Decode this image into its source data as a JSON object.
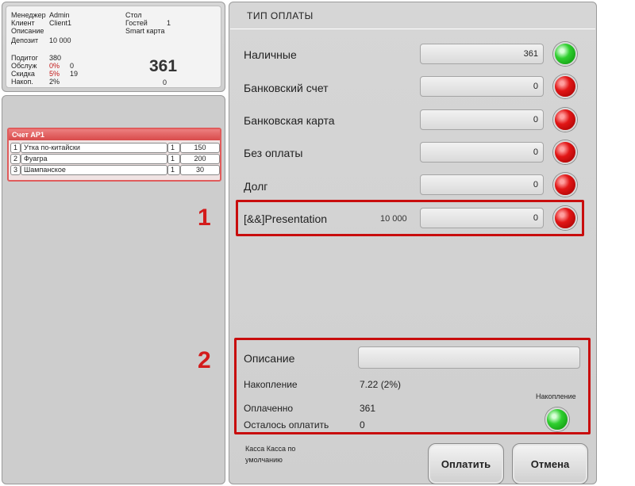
{
  "info": {
    "manager_label": "Менеджер",
    "manager_value": "Admin",
    "client_label": "Клиент",
    "client_value": "Client1",
    "description_label": "Описание",
    "deposit_label": "Депозит",
    "deposit_value": "10 000",
    "table_label": "Стол",
    "guests_label": "Гостей",
    "guests_value": "1",
    "card_label": "Smart карта",
    "subtotal_label": "Подитог",
    "subtotal_value": "380",
    "service_label": "Обслуж",
    "service_pct": "0%",
    "service_value": "0",
    "discount_label": "Скидка",
    "discount_pct": "5%",
    "discount_value": "19",
    "accum_label": "Накоп.",
    "accum_pct": "2%",
    "total": "361",
    "total_sub": "0"
  },
  "bill": {
    "title": "Счет AP1",
    "items": [
      {
        "num": "1",
        "name": "Утка по-китайски",
        "qty": "1",
        "price": "150"
      },
      {
        "num": "2",
        "name": "Фуагра",
        "qty": "1",
        "price": "200"
      },
      {
        "num": "3",
        "name": "Шампанское",
        "qty": "1",
        "price": "30"
      }
    ]
  },
  "payment": {
    "title": "ТИП ОПЛАТЫ",
    "methods": [
      {
        "label": "Наличные",
        "value": "361",
        "status": "green"
      },
      {
        "label": "Банковский счет",
        "value": "0",
        "status": "red"
      },
      {
        "label": "Банковская карта",
        "value": "0",
        "status": "red"
      },
      {
        "label": "Без оплаты",
        "value": "0",
        "status": "red"
      },
      {
        "label": "Долг",
        "value": "0",
        "status": "red"
      },
      {
        "label": "[&&]Presentation",
        "extra": "10 000",
        "value": "0",
        "status": "red"
      }
    ],
    "description_label": "Описание",
    "accumulation_label": "Накопление",
    "accumulation_value": "7.22 (2%)",
    "paid_label": "Оплаченно",
    "paid_value": "361",
    "remaining_label": "Осталось оплатить",
    "remaining_value": "0",
    "accum_toggle_label": "Накопление",
    "kassa_text": "Касса  Касса по умолчанию",
    "pay_button": "Оплатить",
    "cancel_button": "Отмена"
  },
  "callouts": {
    "one": "1",
    "two": "2"
  },
  "colors": {
    "highlight": "#c80d0d",
    "status_red": "#e21616",
    "status_green": "#2fcf2f",
    "bill_header": "#d84a4a"
  }
}
